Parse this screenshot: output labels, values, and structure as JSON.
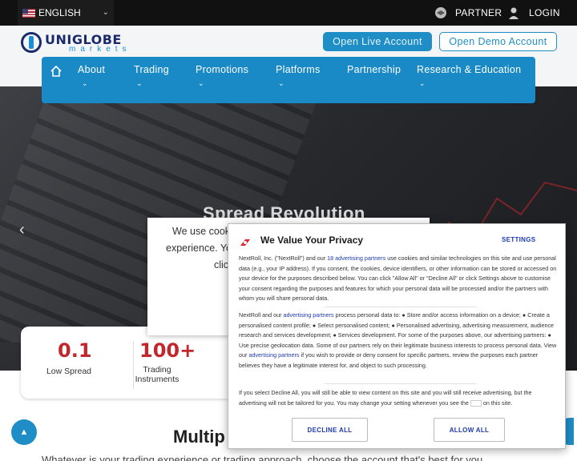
{
  "topbar": {
    "language": "ENGLISH",
    "partner_label": "PARTNER",
    "login_label": "LOGIN"
  },
  "header": {
    "logo_text": "UNIGLOBE",
    "logo_sub": "markets",
    "live_button": "Open Live Account",
    "demo_button": "Open Demo Account"
  },
  "nav": {
    "items": [
      {
        "label": "About"
      },
      {
        "label": "Trading"
      },
      {
        "label": "Promotions"
      },
      {
        "label": "Platforms"
      },
      {
        "label": "Partnership"
      },
      {
        "label": "Research & Education"
      }
    ]
  },
  "hero": {
    "title": "Spread Revolution"
  },
  "stats": [
    {
      "value": "0.1",
      "label": "Low Spread"
    },
    {
      "value": "100+",
      "label": "Trading Instruments"
    }
  ],
  "cookie": {
    "line1": "We use cook",
    "line2": "experience. Yo",
    "line3": "clic"
  },
  "bottom": {
    "title": "Multip",
    "subtitle": "Whatever is your trading experience or trading approach, choose the account that's best for you"
  },
  "privacy": {
    "title": "We Value Your Privacy",
    "settings": "SETTINGS",
    "p1_a": "NextRoll, Inc. (\"NextRoll\") and our ",
    "p1_link": "18 advertising partners",
    "p1_b": " use cookies and similar technologies on this site and use personal data (e.g., your IP address). If you consent, the cookies, device identifiers, or other information can be stored or accessed on your device for the purposes described below. You can click \"Allow All\" or \"Decline All\" or click Settings above to customise your consent regarding the purposes and features for which your personal data will be processed and/or the partners with whom you will share personal data.",
    "p2_a": "NextRoll and our ",
    "p2_link": "advertising partners",
    "p2_b": " process personal data to: ● Store and/or access information on a device; ● Create a personalised content profile; ● Select personalised content; ● Personalised advertising, advertising measurement, audience research and services development; ● Services development. For some of the purposes above, our advertising partners: ● Use precise geolocation data. Some of our partners rely on their legitimate business interests to process personal data. View our ",
    "p2_link2": "advertising partners",
    "p2_c": " if you wish to provide or deny consent for specific partners, review the purposes each partner believes they have a legitimate interest for, and object to such processing.",
    "p3_a": "If you select Decline All, you will still be able to view content on this site and you will still receive advertising, but the advertising will not be tailored for you. You may change your setting whenever you see the ",
    "p3_b": " on this site.",
    "decline": "DECLINE ALL",
    "allow": "ALLOW ALL"
  },
  "colors": {
    "accent": "#1f8ec6",
    "nav": "#1a8ac6",
    "stat_red": "#c1272d",
    "link_blue": "#1e3bb0"
  }
}
